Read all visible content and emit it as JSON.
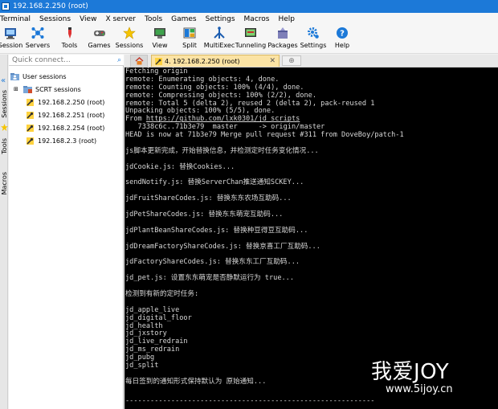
{
  "window": {
    "title": "192.168.2.250 (root)"
  },
  "menu": [
    "Terminal",
    "Sessions",
    "View",
    "X server",
    "Tools",
    "Games",
    "Settings",
    "Macros",
    "Help"
  ],
  "toolbar": [
    {
      "label": "Session",
      "icon": "session-icon"
    },
    {
      "label": "Servers",
      "icon": "servers-icon"
    },
    {
      "label": "Tools",
      "icon": "tools-icon"
    },
    {
      "label": "Games",
      "icon": "games-icon"
    },
    {
      "label": "Sessions",
      "icon": "sessions-star-icon"
    },
    {
      "label": "View",
      "icon": "view-icon"
    },
    {
      "label": "Split",
      "icon": "split-icon"
    },
    {
      "label": "MultiExec",
      "icon": "multiexec-icon"
    },
    {
      "label": "Tunneling",
      "icon": "tunneling-icon"
    },
    {
      "label": "Packages",
      "icon": "packages-icon"
    },
    {
      "label": "Settings",
      "icon": "settings-gear-icon"
    },
    {
      "label": "Help",
      "icon": "help-icon"
    }
  ],
  "sidebar": {
    "quick_connect_placeholder": "Quick connect...",
    "vertical_tabs": [
      "Sessions",
      "Tools",
      "Macros"
    ],
    "tree": [
      {
        "label": "User sessions",
        "icon": "folder-user-icon"
      },
      {
        "label": "SCRT sessions",
        "icon": "folder-scrt-icon"
      },
      {
        "label": "192.168.2.250 (root)",
        "icon": "ssh-key-icon"
      },
      {
        "label": "192.168.2.251 (root)",
        "icon": "ssh-key-icon"
      },
      {
        "label": "192.168.2.254 (root)",
        "icon": "ssh-key-icon"
      },
      {
        "label": "192.168.2.3 (root)",
        "icon": "ssh-key-icon"
      }
    ]
  },
  "tabs": {
    "active_label": "4. 192.168.2.250 (root)"
  },
  "terminal": {
    "lines": [
      "Fetching origin",
      "remote: Enumerating objects: 4, done.",
      "remote: Counting objects: 100% (4/4), done.",
      "remote: Compressing objects: 100% (2/2), done.",
      "remote: Total 5 (delta 2), reused 2 (delta 2), pack-reused 1",
      "Unpacking objects: 100% (5/5), done.",
      "From https://github.com/lxk0301/jd_scripts",
      "   7338c6c..71b3e79  master     -> origin/master",
      "HEAD is now at 71b3e79 Merge pull request #311 from DoveBoy/patch-1",
      "",
      "js脚本更新完成，开始替换信息，并检测定时任务变化情况...",
      "",
      "jdCookie.js: 替换Cookies...",
      "",
      "sendNotify.js: 替换ServerChan推送通知SCKEY...",
      "",
      "jdFruitShareCodes.js: 替换东东农场互助码...",
      "",
      "jdPetShareCodes.js: 替换东东萌宠互助码...",
      "",
      "jdPlantBeanShareCodes.js: 替换种豆得豆互助码...",
      "",
      "jdDreamFactoryShareCodes.js: 替换京喜工厂互助码...",
      "",
      "jdFactoryShareCodes.js: 替换东东工厂互助码...",
      "",
      "jd_pet.js: 设置东东萌宠是否静默运行为 true...",
      "",
      "检测到有新的定时任务:",
      "",
      "jd_apple_live",
      "jd_digital_floor",
      "jd_health",
      "jd_jxstory",
      "jd_live_redrain",
      "jd_ms_redrain",
      "jd_pubg",
      "jd_split",
      "",
      "每日签到的通知形式保持默认为 原始通知..."
    ],
    "divider": "------------------------------------------------------------"
  },
  "watermark": {
    "title": "我爱JOY",
    "url": "www.5ijoy.cn"
  },
  "colors": {
    "titlebar": "#1c79d8",
    "active_tab": "#fbe3a4",
    "terminal_bg": "#000000",
    "terminal_fg": "#d8d8d8"
  }
}
